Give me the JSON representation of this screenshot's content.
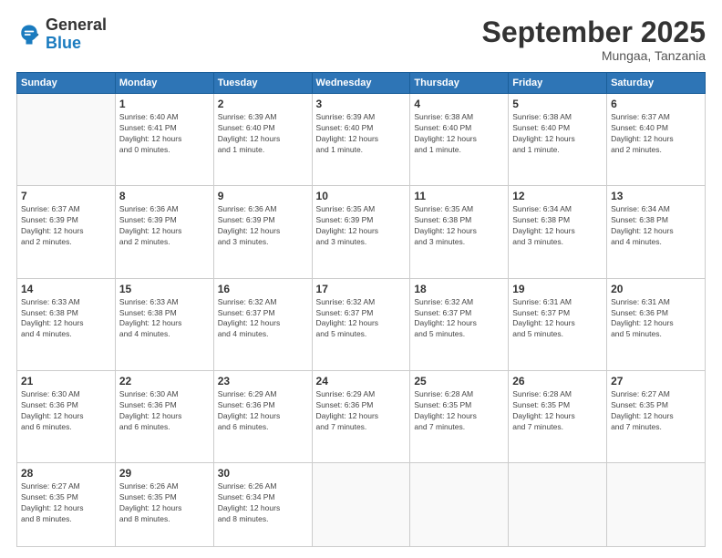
{
  "header": {
    "logo_general": "General",
    "logo_blue": "Blue",
    "month_title": "September 2025",
    "location": "Mungaa, Tanzania"
  },
  "days_of_week": [
    "Sunday",
    "Monday",
    "Tuesday",
    "Wednesday",
    "Thursday",
    "Friday",
    "Saturday"
  ],
  "weeks": [
    [
      {
        "day": "",
        "info": ""
      },
      {
        "day": "1",
        "info": "Sunrise: 6:40 AM\nSunset: 6:41 PM\nDaylight: 12 hours\nand 0 minutes."
      },
      {
        "day": "2",
        "info": "Sunrise: 6:39 AM\nSunset: 6:40 PM\nDaylight: 12 hours\nand 1 minute."
      },
      {
        "day": "3",
        "info": "Sunrise: 6:39 AM\nSunset: 6:40 PM\nDaylight: 12 hours\nand 1 minute."
      },
      {
        "day": "4",
        "info": "Sunrise: 6:38 AM\nSunset: 6:40 PM\nDaylight: 12 hours\nand 1 minute."
      },
      {
        "day": "5",
        "info": "Sunrise: 6:38 AM\nSunset: 6:40 PM\nDaylight: 12 hours\nand 1 minute."
      },
      {
        "day": "6",
        "info": "Sunrise: 6:37 AM\nSunset: 6:40 PM\nDaylight: 12 hours\nand 2 minutes."
      }
    ],
    [
      {
        "day": "7",
        "info": "Sunrise: 6:37 AM\nSunset: 6:39 PM\nDaylight: 12 hours\nand 2 minutes."
      },
      {
        "day": "8",
        "info": "Sunrise: 6:36 AM\nSunset: 6:39 PM\nDaylight: 12 hours\nand 2 minutes."
      },
      {
        "day": "9",
        "info": "Sunrise: 6:36 AM\nSunset: 6:39 PM\nDaylight: 12 hours\nand 3 minutes."
      },
      {
        "day": "10",
        "info": "Sunrise: 6:35 AM\nSunset: 6:39 PM\nDaylight: 12 hours\nand 3 minutes."
      },
      {
        "day": "11",
        "info": "Sunrise: 6:35 AM\nSunset: 6:38 PM\nDaylight: 12 hours\nand 3 minutes."
      },
      {
        "day": "12",
        "info": "Sunrise: 6:34 AM\nSunset: 6:38 PM\nDaylight: 12 hours\nand 3 minutes."
      },
      {
        "day": "13",
        "info": "Sunrise: 6:34 AM\nSunset: 6:38 PM\nDaylight: 12 hours\nand 4 minutes."
      }
    ],
    [
      {
        "day": "14",
        "info": "Sunrise: 6:33 AM\nSunset: 6:38 PM\nDaylight: 12 hours\nand 4 minutes."
      },
      {
        "day": "15",
        "info": "Sunrise: 6:33 AM\nSunset: 6:38 PM\nDaylight: 12 hours\nand 4 minutes."
      },
      {
        "day": "16",
        "info": "Sunrise: 6:32 AM\nSunset: 6:37 PM\nDaylight: 12 hours\nand 4 minutes."
      },
      {
        "day": "17",
        "info": "Sunrise: 6:32 AM\nSunset: 6:37 PM\nDaylight: 12 hours\nand 5 minutes."
      },
      {
        "day": "18",
        "info": "Sunrise: 6:32 AM\nSunset: 6:37 PM\nDaylight: 12 hours\nand 5 minutes."
      },
      {
        "day": "19",
        "info": "Sunrise: 6:31 AM\nSunset: 6:37 PM\nDaylight: 12 hours\nand 5 minutes."
      },
      {
        "day": "20",
        "info": "Sunrise: 6:31 AM\nSunset: 6:36 PM\nDaylight: 12 hours\nand 5 minutes."
      }
    ],
    [
      {
        "day": "21",
        "info": "Sunrise: 6:30 AM\nSunset: 6:36 PM\nDaylight: 12 hours\nand 6 minutes."
      },
      {
        "day": "22",
        "info": "Sunrise: 6:30 AM\nSunset: 6:36 PM\nDaylight: 12 hours\nand 6 minutes."
      },
      {
        "day": "23",
        "info": "Sunrise: 6:29 AM\nSunset: 6:36 PM\nDaylight: 12 hours\nand 6 minutes."
      },
      {
        "day": "24",
        "info": "Sunrise: 6:29 AM\nSunset: 6:36 PM\nDaylight: 12 hours\nand 7 minutes."
      },
      {
        "day": "25",
        "info": "Sunrise: 6:28 AM\nSunset: 6:35 PM\nDaylight: 12 hours\nand 7 minutes."
      },
      {
        "day": "26",
        "info": "Sunrise: 6:28 AM\nSunset: 6:35 PM\nDaylight: 12 hours\nand 7 minutes."
      },
      {
        "day": "27",
        "info": "Sunrise: 6:27 AM\nSunset: 6:35 PM\nDaylight: 12 hours\nand 7 minutes."
      }
    ],
    [
      {
        "day": "28",
        "info": "Sunrise: 6:27 AM\nSunset: 6:35 PM\nDaylight: 12 hours\nand 8 minutes."
      },
      {
        "day": "29",
        "info": "Sunrise: 6:26 AM\nSunset: 6:35 PM\nDaylight: 12 hours\nand 8 minutes."
      },
      {
        "day": "30",
        "info": "Sunrise: 6:26 AM\nSunset: 6:34 PM\nDaylight: 12 hours\nand 8 minutes."
      },
      {
        "day": "",
        "info": ""
      },
      {
        "day": "",
        "info": ""
      },
      {
        "day": "",
        "info": ""
      },
      {
        "day": "",
        "info": ""
      }
    ]
  ]
}
